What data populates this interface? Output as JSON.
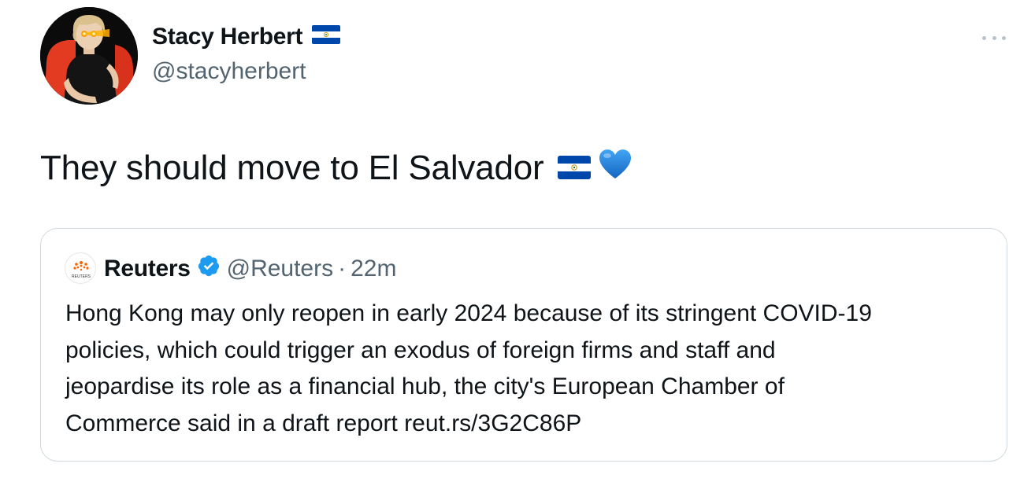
{
  "author": {
    "display_name": "Stacy Herbert",
    "handle": "@stacyherbert",
    "flag_icon": "el-salvador-flag-icon",
    "avatar_icon": "profile-photo-avatar"
  },
  "tweet": {
    "text": "They should move to El Salvador",
    "emoji": [
      "el-salvador-flag-icon",
      "blue-heart-icon"
    ]
  },
  "quoted": {
    "name": "Reuters",
    "handle": "@Reuters",
    "separator": "·",
    "time": "22m",
    "avatar_label": "REUTERS",
    "verified_icon": "verified-badge-icon",
    "lines": [
      "Hong Kong may only reopen in early 2024 because of its stringent COVID-19",
      "policies, which could trigger an exodus of foreign firms and staff and",
      "jeopardise its role as a financial hub, the city's European Chamber of",
      "Commerce said in a draft report reut.rs/3G2C86P"
    ]
  },
  "colors": {
    "text_primary": "#0f1419",
    "text_secondary": "#536471",
    "border": "#cfd9de",
    "verified_blue": "#1d9bf0",
    "heart_blue": "#1e88e5",
    "reuters_orange": "#fa6400"
  }
}
